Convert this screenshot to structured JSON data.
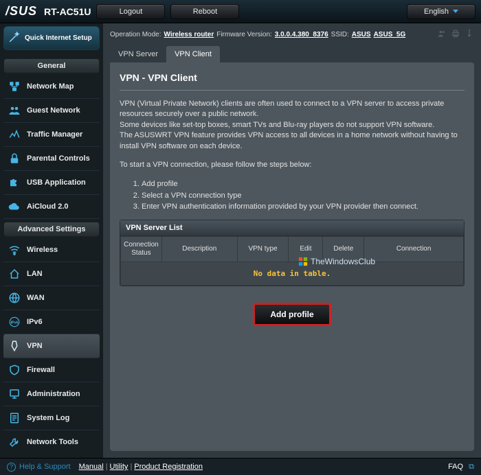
{
  "header": {
    "brand": "/SUS",
    "model": "RT-AC51U",
    "logout": "Logout",
    "reboot": "Reboot",
    "language": "English"
  },
  "status": {
    "op_mode_lbl": "Operation Mode:",
    "op_mode_val": "Wireless router",
    "fw_lbl": "Firmware Version:",
    "fw_val": "3.0.0.4.380_8376",
    "ssid_lbl": "SSID:",
    "ssid1": "ASUS",
    "ssid2": "ASUS_5G"
  },
  "sidebar": {
    "qis": "Quick Internet Setup",
    "general_title": "General",
    "general": [
      {
        "label": "Network Map"
      },
      {
        "label": "Guest Network"
      },
      {
        "label": "Traffic Manager"
      },
      {
        "label": "Parental Controls"
      },
      {
        "label": "USB Application"
      },
      {
        "label": "AiCloud 2.0"
      }
    ],
    "advanced_title": "Advanced Settings",
    "advanced": [
      {
        "label": "Wireless"
      },
      {
        "label": "LAN"
      },
      {
        "label": "WAN"
      },
      {
        "label": "IPv6"
      },
      {
        "label": "VPN"
      },
      {
        "label": "Firewall"
      },
      {
        "label": "Administration"
      },
      {
        "label": "System Log"
      },
      {
        "label": "Network Tools"
      }
    ]
  },
  "tabs": [
    {
      "label": "VPN Server"
    },
    {
      "label": "VPN Client"
    }
  ],
  "panel": {
    "title": "VPN - VPN Client",
    "p1": "VPN (Virtual Private Network) clients are often used to connect to a VPN server to access private resources securely over a public network.",
    "p2": "Some devices like set-top boxes, smart TVs and Blu-ray players do not support VPN software.",
    "p3": "The ASUSWRT VPN feature provides VPN access to all devices in a home network without having to install VPN software on each device.",
    "p4": "To start a VPN connection, please follow the steps below:",
    "steps": [
      "Add profile",
      "Select a VPN connection type",
      "Enter VPN authentication information provided by your VPN provider then connect."
    ]
  },
  "server_list": {
    "title": "VPN Server List",
    "cols": [
      "Connection Status",
      "Description",
      "VPN type",
      "Edit",
      "Delete",
      "Connection"
    ],
    "nodata": "No data in table.",
    "add_btn": "Add profile"
  },
  "watermark": "TheWindowsClub",
  "footer": {
    "help": "Help & Support",
    "links": [
      "Manual",
      "Utility",
      "Product Registration"
    ],
    "faq": "FAQ"
  }
}
